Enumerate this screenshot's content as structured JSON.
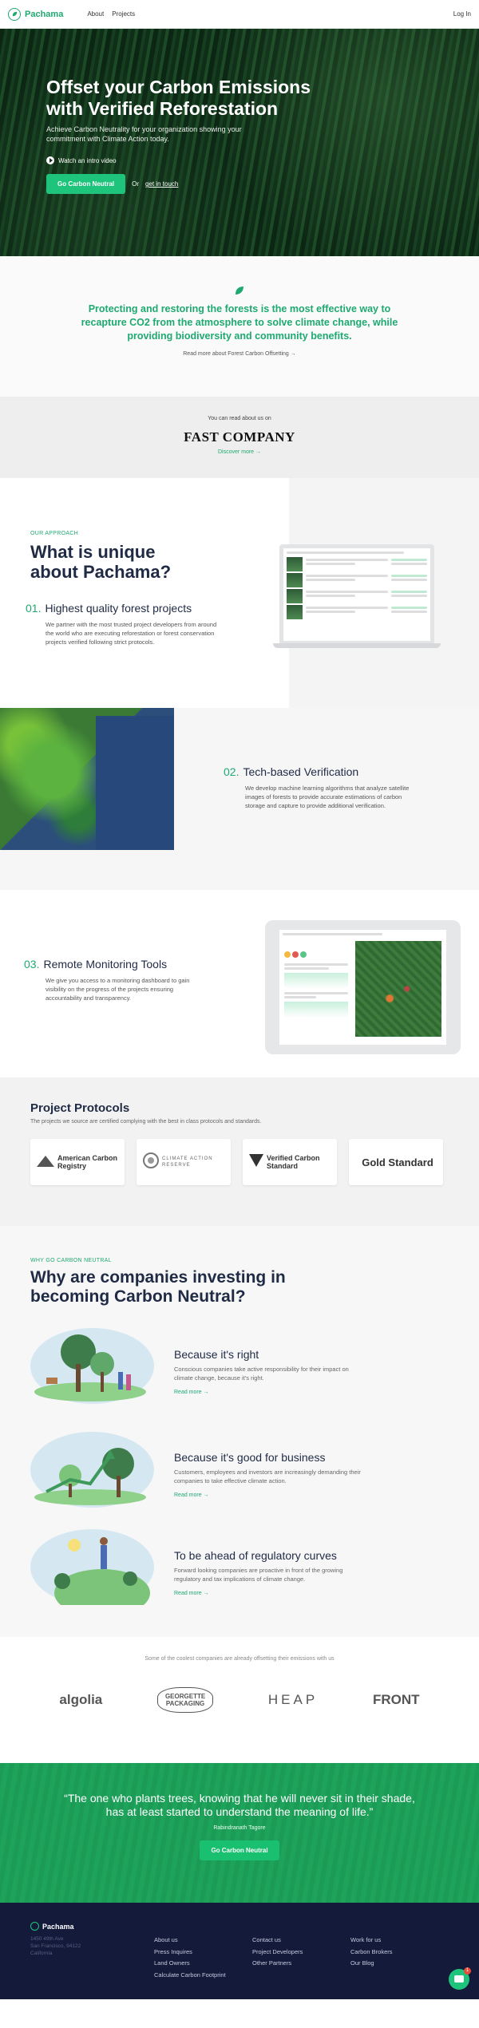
{
  "nav": {
    "brand": "Pachama",
    "links": [
      "About",
      "Projects"
    ],
    "login": "Log In"
  },
  "hero": {
    "title": "Offset your Carbon Emissions with Verified Reforestation",
    "subtitle": "Achieve Carbon Neutrality for your organization showing your commitment with Climate Action today.",
    "watch": "Watch an intro video",
    "cta": "Go Carbon Neutral",
    "or": "Or",
    "touch": "get in touch"
  },
  "mission": {
    "text": "Protecting and restoring the forests is the most effective way to recapture CO2 from the atmosphere to solve climate change, while providing biodiversity and community benefits.",
    "link": "Read more about Forest Carbon Offsetting →"
  },
  "press": {
    "label": "You can read about us on",
    "logo": "FAST COMPANY",
    "link": "Discover more →"
  },
  "approach": {
    "tag": "OUR APPROACH",
    "title": "What is unique about Pachama?",
    "features": [
      {
        "num": "01.",
        "title": "Highest quality forest projects",
        "text": "We partner with the most trusted project developers from around the world who are executing reforestation or forest conservation projects verified following strict protocols."
      },
      {
        "num": "02.",
        "title": "Tech-based Verification",
        "text": "We develop machine learning algorithms that analyze satellite images of forests to provide accurate estimations of carbon storage and capture to provide additional verification."
      },
      {
        "num": "03.",
        "title": "Remote Monitoring Tools",
        "text": "We give you access to a monitoring dashboard to gain visibility on the progress of the projects ensuring accountability and transparency."
      }
    ]
  },
  "protocols": {
    "title": "Project Protocols",
    "subtitle": "The projects we source are certified complying with the best in class protocols and standards.",
    "cards": [
      {
        "name": "American Carbon Registry",
        "icon": "acr-icon"
      },
      {
        "name": "CLIMATE ACTION RESERVE",
        "icon": "car-icon"
      },
      {
        "name": "Verified Carbon Standard",
        "icon": "vcs-icon"
      },
      {
        "name": "Gold Standard",
        "icon": "gold-standard-icon"
      }
    ]
  },
  "why": {
    "tag": "WHY GO CARBON NEUTRAL",
    "title": "Why are companies investing in becoming Carbon Neutral?",
    "reasons": [
      {
        "title": "Because it's right",
        "text": "Conscious companies take active responsibility for their impact on climate change, because it's right.",
        "link": "Read more →"
      },
      {
        "title": "Because it's good for business",
        "text": "Customers, employees and investors are increasingly demanding their companies to take effective climate action.",
        "link": "Read more →"
      },
      {
        "title": "To be ahead of regulatory curves",
        "text": "Forward looking companies are proactive in front of the growing regulatory and tax implications of climate change.",
        "link": "Read more →"
      }
    ]
  },
  "clients": {
    "label": "Some of the coolest companies are already offsetting their emissions with us",
    "logos": [
      "algolia",
      "GEORGETTE PACKAGING",
      "HEAP",
      "FRONT"
    ]
  },
  "quote": {
    "text": "“The one who plants trees, knowing that he will never sit in their shade, has at least started to understand the meaning of life.”",
    "author": "Rabindranath Tagore",
    "cta": "Go Carbon Neutral"
  },
  "footer": {
    "brand": "Pachama",
    "address": [
      "1450 49th Ave",
      "San Francisco, 94122",
      "California"
    ],
    "col1": [
      "About us",
      "Press Inquires",
      "Land Owners",
      "Calculate Carbon Footprint"
    ],
    "col2": [
      "Contact us",
      "Project Developers",
      "Other Partners"
    ],
    "col3": [
      "Work for us",
      "Carbon Brokers",
      "Our Blog"
    ],
    "chat_badge": "1"
  },
  "colors": {
    "accent": "#1fa971",
    "dark": "#1f2a44",
    "footer": "#131a3a"
  }
}
